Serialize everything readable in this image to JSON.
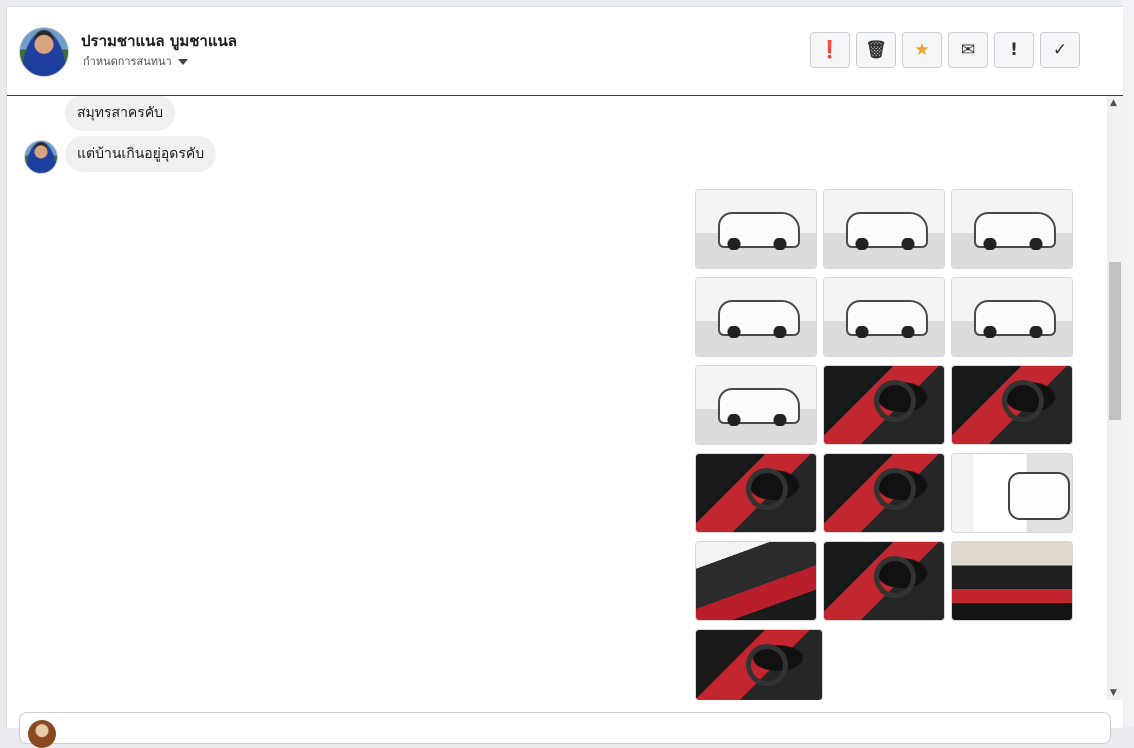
{
  "header": {
    "user_name": "ปรามชาแนล บูมชาแนล",
    "conversation_setting": "กำหนดการสนทนา",
    "toolbar": [
      {
        "icon": "alert-circle-icon",
        "glyph": "❗"
      },
      {
        "icon": "trash-icon",
        "glyph": "🗑"
      },
      {
        "icon": "star-icon",
        "glyph": "★"
      },
      {
        "icon": "envelope-icon",
        "glyph": "✉"
      },
      {
        "icon": "exclamation-icon",
        "glyph": "!"
      },
      {
        "icon": "check-icon",
        "glyph": "✓"
      }
    ]
  },
  "messages": [
    {
      "text": "สมุทรสาครคับ"
    },
    {
      "text": "แต่บ้านเกินอยู่อุดรคับ"
    }
  ],
  "photos": [
    {
      "kind": "exterior"
    },
    {
      "kind": "exterior"
    },
    {
      "kind": "exterior"
    },
    {
      "kind": "exterior"
    },
    {
      "kind": "exterior"
    },
    {
      "kind": "exterior"
    },
    {
      "kind": "exterior"
    },
    {
      "kind": "interior"
    },
    {
      "kind": "interior"
    },
    {
      "kind": "interior"
    },
    {
      "kind": "interior"
    },
    {
      "kind": "side-graphics"
    },
    {
      "kind": "door"
    },
    {
      "kind": "interior"
    },
    {
      "kind": "dashboard"
    },
    {
      "kind": "interior"
    }
  ],
  "scrollbar": {
    "up_icon": "▲",
    "down_icon": "▼"
  }
}
